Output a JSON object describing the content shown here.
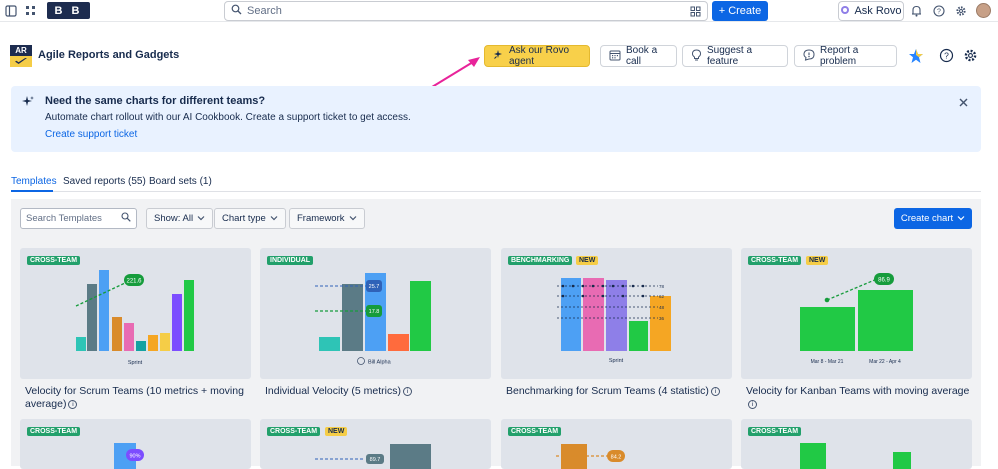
{
  "topbar": {
    "brand": "B B",
    "search_placeholder": "Search",
    "create_label": "Create",
    "ask_rovo_label": "Ask Rovo"
  },
  "app": {
    "logo_text": "AR",
    "title": "Agile Reports and Gadgets",
    "ask_agent_label": "Ask our Rovo agent",
    "book_call_label": "Book a call",
    "suggest_label": "Suggest a feature",
    "report_label": "Report a problem"
  },
  "banner": {
    "title": "Need the same charts for different teams?",
    "text": "Automate chart rollout with our AI Cookbook. Create a support ticket to get access.",
    "link": "Create support ticket"
  },
  "tabs": [
    {
      "label": "Templates"
    },
    {
      "label": "Saved reports (55)"
    },
    {
      "label": "Board sets (1)"
    }
  ],
  "toolbar": {
    "search_placeholder": "Search Templates",
    "show_label": "Show: All",
    "chart_type_label": "Chart type",
    "framework_label": "Framework",
    "create_chart_label": "Create chart"
  },
  "cards": [
    {
      "badges": [
        "CROSS-TEAM"
      ],
      "title": "Velocity for Scrum Teams (10 metrics + moving average)",
      "thumb_value": "221.6",
      "thumb_axis": "Sprint"
    },
    {
      "badges": [
        "INDIVIDUAL"
      ],
      "title": "Individual Velocity (5 metrics)",
      "thumb_values": [
        "25.7",
        "17.8"
      ],
      "thumb_axis": "Bill Alpha"
    },
    {
      "badges": [
        "BENCHMARKING",
        "NEW"
      ],
      "title": "Benchmarking for Scrum Teams (4 statistic)",
      "thumb_values": [
        "78",
        "62",
        "48",
        "36"
      ],
      "thumb_axis": "Sprint"
    },
    {
      "badges": [
        "CROSS-TEAM",
        "NEW"
      ],
      "title": "Velocity for Kanban Teams with moving average",
      "thumb_value": "86.9",
      "thumb_axis_a": "Mar 8 - Mar 21",
      "thumb_axis_b": "Mar 22 - Apr 4"
    }
  ],
  "row2": [
    {
      "badges": [
        "CROSS-TEAM"
      ],
      "value": "90%"
    },
    {
      "badges": [
        "CROSS-TEAM",
        "NEW"
      ],
      "value": "89.7"
    },
    {
      "badges": [
        "CROSS-TEAM"
      ],
      "value": "84.2"
    },
    {
      "badges": [
        "CROSS-TEAM"
      ]
    }
  ],
  "colors": {
    "accent": "#0c66e4",
    "annotation_arrow": "#e8239a",
    "ask_agent_bg": "#f8d04a",
    "banner_bg": "#e9f2ff"
  }
}
